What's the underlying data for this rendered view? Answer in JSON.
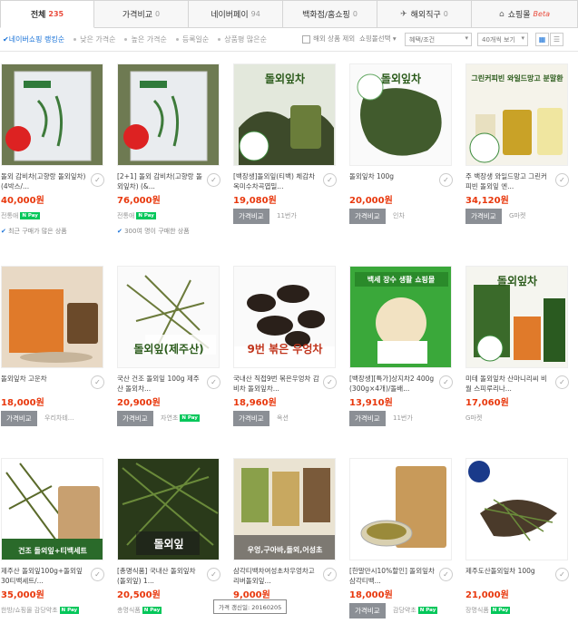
{
  "tabs": [
    {
      "label": "전체",
      "count": "235",
      "active": true
    },
    {
      "label": "가격비교",
      "count": "0"
    },
    {
      "label": "네이버페이",
      "count": "94"
    },
    {
      "label": "백화점/홈쇼핑",
      "count": "0"
    },
    {
      "label": "해외직구",
      "count": "0",
      "icon": "plane-icon"
    },
    {
      "label": "쇼핑몰",
      "beta": "Beta",
      "icon": "home-icon"
    }
  ],
  "sort": {
    "options": [
      "네이버쇼핑 랭킹순",
      "낮은 가격순",
      "높은 가격순",
      "등록일순",
      "상품평 많은순"
    ],
    "active": 0,
    "exclude_label": "해외 상품 제외",
    "delivery_select": "쇼핑몰선택",
    "price_select": "혜택/조건",
    "perpage_select": "40개씩 보기"
  },
  "products": [
    {
      "title": "돌외 감비차(고향랑 돌외잎차) (4박스/...",
      "price": "40,000원",
      "mall": "전통애",
      "npay": true,
      "note": "최근 구매가 많은 상품",
      "img": "box-green"
    },
    {
      "title": "[2+1] 돌외 감비차(고향랑 돌외잎차) (&...",
      "price": "76,000원",
      "mall": "전통애",
      "npay": true,
      "note": "300여 명이 구매한 상품",
      "img": "box-green2"
    },
    {
      "title": "[백장생]돌외잎(티백) 체감차 옥미수차곡엽밀...",
      "price": "19,080원",
      "compare": "가격비교",
      "mall": "11번가",
      "img": "tea-jar",
      "text": "돌외잎차"
    },
    {
      "title": "돌외잎차 100g",
      "price": "20,000원",
      "compare": "가격비교",
      "mall": "인차",
      "img": "leaves",
      "text": "돌외잎차"
    },
    {
      "title": "주 백장생 와일드망고 그린커피빈 돌외잎 엔...",
      "price": "34,120원",
      "compare": "가격비교",
      "mall": "G마켓",
      "img": "bottles",
      "text": "그린커피빈 와일드망고 분말환"
    },
    {
      "title": "돌외잎차 고운차",
      "price": "18,000원",
      "compare": "가격비교",
      "mall": "우리차테...",
      "img": "box-orange"
    },
    {
      "title": "국산 건조 돌외잎 100g 제주산 돌외차...",
      "price": "20,900원",
      "compare": "가격비교",
      "mall": "자연초",
      "npay": true,
      "img": "herb",
      "text": "돌외잎(제주산)"
    },
    {
      "title": "국내산 직접9번 볶은우엉차 감비차 돌외잎차...",
      "price": "18,960원",
      "compare": "가격비교",
      "mall": "옥션",
      "img": "roots",
      "text": "9번 볶은 우엉차"
    },
    {
      "title": "[백장생][특가]상지차2 400g (300g×4개)/돌배...",
      "price": "13,910원",
      "compare": "가격비교",
      "mall": "11번가",
      "img": "green-ad",
      "text": "백세 장수 생활 쇼핑몰"
    },
    {
      "title": "미테 돌외잎차 산마니리씨 비월 스피루리나...",
      "price": "17,060원",
      "mall": "G마켓",
      "img": "pack",
      "text": "돌외잎차"
    },
    {
      "title": "제주산 돌외잎100g+돌외잎30티백세트/...",
      "price": "35,000원",
      "mall": "한방/쇼핑몰 감당약초",
      "npay": true,
      "img": "pouch",
      "text": "건조 돌외잎+티백세트"
    },
    {
      "title": "[총명식품] 국내산 돌외잎차(돌외잎) 1...",
      "price": "20,500원",
      "mall": "총명식품",
      "npay": true,
      "img": "dark-herb",
      "text": "돌외잎"
    },
    {
      "title": "삼각티백차여성초차우엉차고리버돌외잎...",
      "price": "9,000원",
      "mall": "",
      "npay": true,
      "img": "tea-packs",
      "text": "우엉,구아바,돌외,어성초"
    },
    {
      "title": "[한말만시10%할인] 돌외잎차 삼각티백...",
      "price": "18,000원",
      "compare": "가격비교",
      "mall": "감당약초",
      "npay": true,
      "img": "tea-cup"
    },
    {
      "title": "제주도산돌외잎차 100g",
      "price": "21,000원",
      "mall": "장명식품",
      "npay": true,
      "img": "dry-herb"
    }
  ],
  "tooltip": "가격 갱신일: 20160205",
  "colors": {
    "accent": "#1a73d8",
    "price": "#e8380d",
    "npay": "#03c75a"
  }
}
